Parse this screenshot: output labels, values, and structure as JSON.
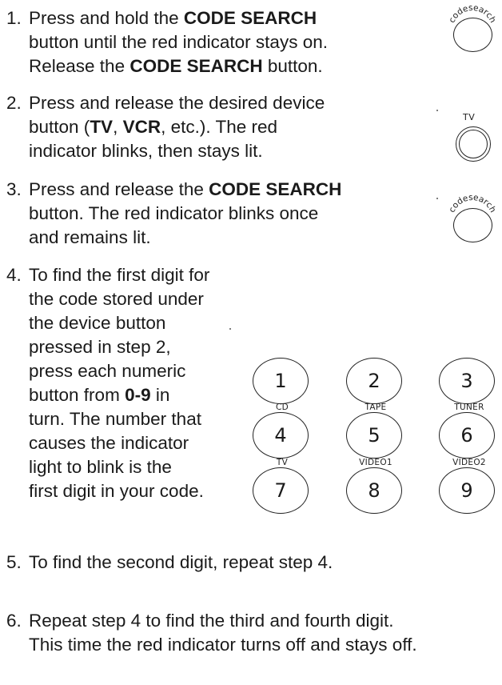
{
  "steps": [
    {
      "number": "1.",
      "lines": [
        [
          "Press and hold the ",
          {
            "b": "CODE SEARCH"
          }
        ],
        [
          "button until the red indicator stays on."
        ],
        [
          "Release the ",
          {
            "b": "CODE SEARCH"
          },
          " button."
        ]
      ]
    },
    {
      "number": "2.",
      "lines": [
        [
          "Press and release the desired device"
        ],
        [
          "button (",
          {
            "b": "TV"
          },
          ", ",
          {
            "b": "VCR"
          },
          ", etc.). The red"
        ],
        [
          "indicator blinks, then stays lit."
        ]
      ]
    },
    {
      "number": "3.",
      "lines": [
        [
          "Press and release the ",
          {
            "b": "CODE SEARCH"
          }
        ],
        [
          "button. The red indicator blinks once"
        ],
        [
          "and remains lit."
        ]
      ]
    },
    {
      "number": "4.",
      "lines": [
        [
          "To find the first digit for"
        ],
        [
          "the code stored under"
        ],
        [
          "the device button"
        ],
        [
          "pressed in step 2,"
        ],
        [
          "press each numeric"
        ],
        [
          "button from ",
          {
            "b": "0-9"
          },
          " in"
        ],
        [
          "turn. The number that"
        ],
        [
          "causes the indicator"
        ],
        [
          "light to blink is the"
        ],
        [
          "first digit in your code."
        ]
      ]
    },
    {
      "number": "5.",
      "lines": [
        [
          "To find the second digit, repeat step 4."
        ]
      ]
    },
    {
      "number": "6.",
      "lines": [
        [
          "Repeat step 4 to find the third and fourth digit."
        ],
        [
          "This time the red indicator turns off and stays off."
        ]
      ]
    }
  ],
  "icons": {
    "code_search_label": "codesearch",
    "tv_label": "TV"
  },
  "keypad": {
    "keys": [
      "1",
      "2",
      "3",
      "4",
      "5",
      "6",
      "7",
      "8",
      "9"
    ],
    "sublabels": [
      "CD",
      "TAPE",
      "TUNER",
      "TV",
      "VIDEO1",
      "VIDEO2"
    ]
  }
}
